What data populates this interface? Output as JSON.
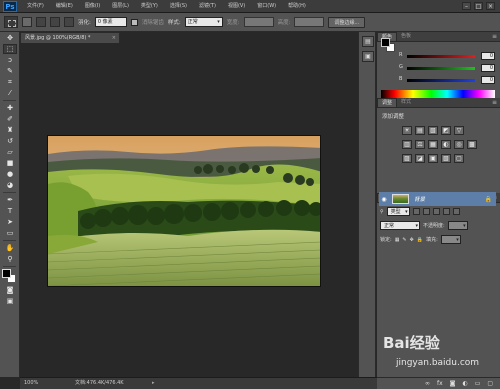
{
  "app": {
    "logo": "Ps"
  },
  "menu": [
    "文件(F)",
    "编辑(E)",
    "图像(I)",
    "图层(L)",
    "类型(Y)",
    "选择(S)",
    "滤镜(T)",
    "视图(V)",
    "窗口(W)",
    "帮助(H)"
  ],
  "window_controls": [
    "minimize-icon",
    "maximize-icon",
    "close-icon"
  ],
  "options": {
    "feather_label": "羽化:",
    "feather_value": "0 像素",
    "antialias_label": "消除锯齿",
    "style_label": "样式:",
    "style_value": "正常",
    "width_label": "宽度:",
    "height_label": "高度:",
    "refine_edge": "调整边缘..."
  },
  "tools": [
    "move-tool-icon",
    "marquee-tool-icon",
    "lasso-tool-icon",
    "quick-select-tool-icon",
    "crop-tool-icon",
    "eyedropper-tool-icon",
    "healing-brush-icon",
    "brush-tool-icon",
    "clone-stamp-icon",
    "history-brush-icon",
    "eraser-tool-icon",
    "gradient-tool-icon",
    "blur-tool-icon",
    "dodge-tool-icon",
    "pen-tool-icon",
    "type-tool-icon",
    "path-select-icon",
    "shape-tool-icon",
    "hand-tool-icon",
    "zoom-tool-icon"
  ],
  "document": {
    "tab_title": "风景.jpg @ 100%(RGB/8) *"
  },
  "status": {
    "zoom": "100%",
    "docinfo": "文档:476.4K/476.4K"
  },
  "color_panel": {
    "tabs": [
      "颜色",
      "色板"
    ],
    "channels": [
      {
        "label": "R",
        "value": "0"
      },
      {
        "label": "G",
        "value": "0"
      },
      {
        "label": "B",
        "value": "0"
      }
    ],
    "colors": {
      "r": "#e02020",
      "g": "#20c020",
      "b": "#2040e0"
    }
  },
  "adjust_panel": {
    "tabs": [
      "调整",
      "样式"
    ],
    "title": "添加调整",
    "row1": [
      "☀",
      "▤",
      "▧",
      "◩",
      "▽"
    ],
    "row2": [
      "▥",
      "⚖",
      "▦",
      "◐",
      "◎",
      "▩"
    ],
    "row3": [
      "▨",
      "◪",
      "▣",
      "▧",
      "▢"
    ]
  },
  "layers_panel": {
    "tabs": [
      "图层",
      "通道",
      "路径"
    ],
    "kind": "类型",
    "blend": "正常",
    "opacity_label": "不透明度:",
    "lock_label": "锁定:",
    "fill_label": "填充:",
    "layer_name": "背景"
  },
  "layer_buttons": [
    "∞",
    "fx",
    "◙",
    "◐",
    "▭",
    "▢",
    "🗑"
  ],
  "watermark": {
    "logo": "Bai经验",
    "url": "jingyan.baidu.com"
  }
}
